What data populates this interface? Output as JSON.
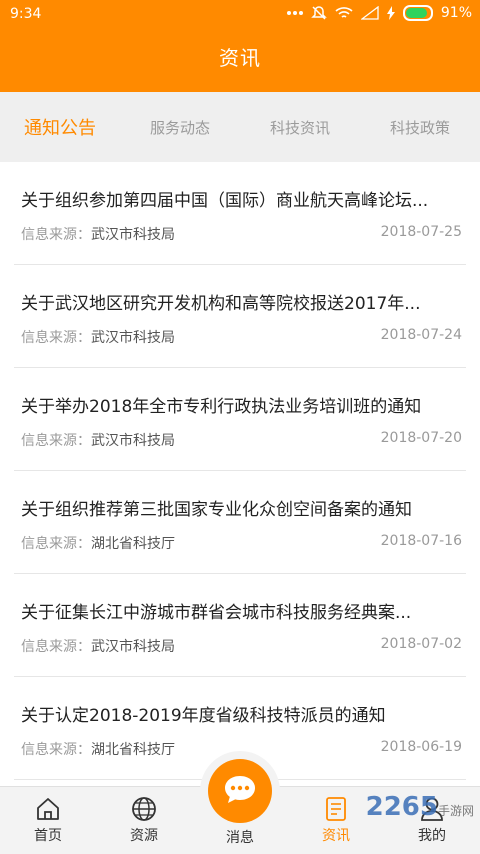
{
  "status_bar": {
    "time": "9:34",
    "battery": "91%"
  },
  "header": {
    "title": "资讯"
  },
  "tabs": [
    {
      "label": "通知公告",
      "active": true
    },
    {
      "label": "服务动态",
      "active": false
    },
    {
      "label": "科技资讯",
      "active": false
    },
    {
      "label": "科技政策",
      "active": false
    }
  ],
  "list": {
    "source_label": "信息来源：",
    "items": [
      {
        "title": "关于组织参加第四届中国（国际）商业航天高峰论坛...",
        "source": "武汉市科技局",
        "date": "2018-07-25"
      },
      {
        "title": "关于武汉地区研究开发机构和高等院校报送2017年...",
        "source": "武汉市科技局",
        "date": "2018-07-24"
      },
      {
        "title": "关于举办2018年全市专利行政执法业务培训班的通知",
        "source": "武汉市科技局",
        "date": "2018-07-20"
      },
      {
        "title": "关于组织推荐第三批国家专业化众创空间备案的通知",
        "source": "湖北省科技厅",
        "date": "2018-07-16"
      },
      {
        "title": "关于征集长江中游城市群省会城市科技服务经典案...",
        "source": "武汉市科技局",
        "date": "2018-07-02"
      },
      {
        "title": "关于认定2018-2019年度省级科技特派员的通知",
        "source": "湖北省科技厅",
        "date": "2018-06-19"
      }
    ]
  },
  "bottom_nav": [
    {
      "label": "首页",
      "icon": "home-icon"
    },
    {
      "label": "资源",
      "icon": "globe-icon"
    },
    {
      "label": "消息",
      "icon": "chat-icon"
    },
    {
      "label": "资讯",
      "icon": "document-icon"
    },
    {
      "label": "我的",
      "icon": "user-icon"
    }
  ],
  "watermark": {
    "main": "2265",
    "sub": "手游网"
  },
  "colors": {
    "accent": "#ff8a00",
    "tab_bg": "#efefef",
    "battery_fill": "#2fd35d"
  }
}
